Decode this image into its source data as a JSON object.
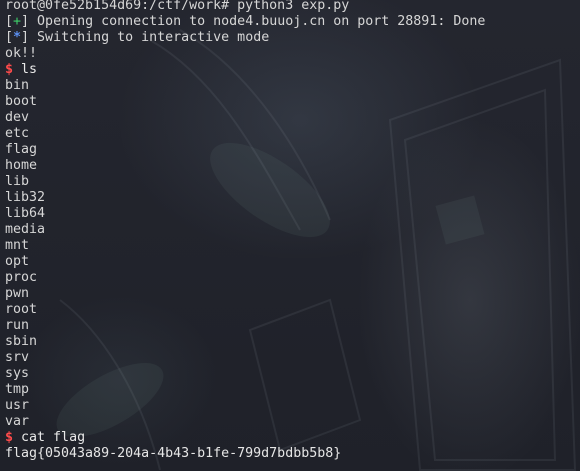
{
  "terminal": {
    "lines": [
      {
        "type": "text",
        "text": "root@0fe52b154d69:/ctf/work# python3 exp.py"
      },
      {
        "type": "status",
        "mark": "+",
        "mark_color": "#3fd16a",
        "text": " Opening connection to node4.buuoj.cn on port 28891: Done"
      },
      {
        "type": "status",
        "mark": "*",
        "mark_color": "#5b8ff0",
        "text": " Switching to interactive mode"
      },
      {
        "type": "text",
        "text": "ok!!"
      },
      {
        "type": "prompt",
        "symbol": "$",
        "command": "ls"
      },
      {
        "type": "text",
        "text": "bin"
      },
      {
        "type": "text",
        "text": "boot"
      },
      {
        "type": "text",
        "text": "dev"
      },
      {
        "type": "text",
        "text": "etc"
      },
      {
        "type": "text",
        "text": "flag"
      },
      {
        "type": "text",
        "text": "home"
      },
      {
        "type": "text",
        "text": "lib"
      },
      {
        "type": "text",
        "text": "lib32"
      },
      {
        "type": "text",
        "text": "lib64"
      },
      {
        "type": "text",
        "text": "media"
      },
      {
        "type": "text",
        "text": "mnt"
      },
      {
        "type": "text",
        "text": "opt"
      },
      {
        "type": "text",
        "text": "proc"
      },
      {
        "type": "text",
        "text": "pwn"
      },
      {
        "type": "text",
        "text": "root"
      },
      {
        "type": "text",
        "text": "run"
      },
      {
        "type": "text",
        "text": "sbin"
      },
      {
        "type": "text",
        "text": "srv"
      },
      {
        "type": "text",
        "text": "sys"
      },
      {
        "type": "text",
        "text": "tmp"
      },
      {
        "type": "text",
        "text": "usr"
      },
      {
        "type": "text",
        "text": "var"
      },
      {
        "type": "prompt",
        "symbol": "$",
        "command": "cat flag"
      },
      {
        "type": "text",
        "text": "flag{05043a89-204a-4b43-b1fe-799d7bdbb5b8}"
      }
    ]
  },
  "colors": {
    "background": "#1e2029",
    "text": "#d6d6d6",
    "prompt_symbol": "#ff4b4b",
    "status_plus": "#3fd16a",
    "status_star": "#5b8ff0"
  }
}
